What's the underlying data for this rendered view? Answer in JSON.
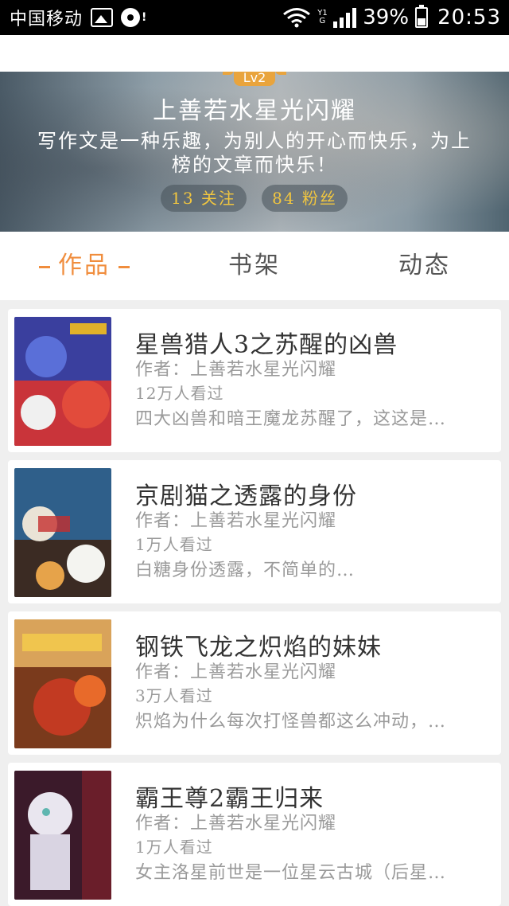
{
  "status_bar": {
    "carrier": "中国移动",
    "network_small": "Y1 G",
    "battery_percent": "39%",
    "time": "20:53"
  },
  "profile": {
    "level": "Lv2",
    "name": "上善若水星光闪耀",
    "bio": "写作文是一种乐趣，为别人的开心而快乐，为上榜的文章而快乐！",
    "following": "13 关注",
    "fans": "84 粉丝"
  },
  "tabs": [
    {
      "label": "作品",
      "active": true
    },
    {
      "label": "书架",
      "active": false
    },
    {
      "label": "动态",
      "active": false
    }
  ],
  "works": [
    {
      "title": "星兽猎人3之苏醒的凶兽",
      "author": "作者：上善若水星光闪耀",
      "views": "12万人看过",
      "desc": "四大凶兽和暗王魔龙苏醒了，这这是…"
    },
    {
      "title": "京剧猫之透露的身份",
      "author": "作者：上善若水星光闪耀",
      "views": "1万人看过",
      "desc": "白糖身份透露，不简单的…"
    },
    {
      "title": "钢铁飞龙之炽焰的妹妹",
      "author": "作者：上善若水星光闪耀",
      "views": "3万人看过",
      "desc": "炽焰为什么每次打怪兽都这么冲动，…"
    },
    {
      "title": "霸王尊2霸王归来",
      "author": "作者：上善若水星光闪耀",
      "views": "1万人看过",
      "desc": "女主洛星前世是一位星云古城（后星…"
    }
  ],
  "colors": {
    "accent": "#f08d3d",
    "stat_text": "#f1c640",
    "level_badge": "#e9a43d"
  }
}
